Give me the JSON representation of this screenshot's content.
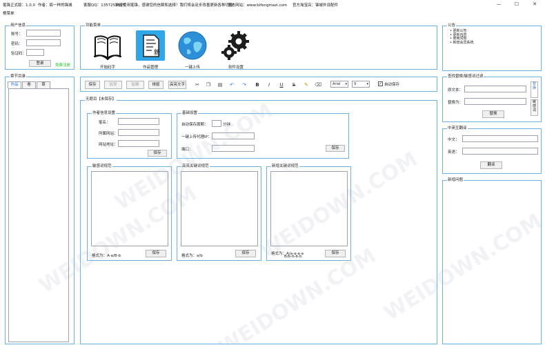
{
  "titlebar": {
    "app_name": "笔锋正式版：1.0.0",
    "author": "作者：疯一样的锋城",
    "qq": "客服QQ：1357252657",
    "welcome": "欢迎使用笔锋，感谢您的信赖和选择！我们将会足步改善更新各种功能！",
    "website": "官方网站：www.bifengmazi.com",
    "taobao": "官方淘宝店：锋城外设配件",
    "minimize": "—",
    "maximize": "☐",
    "close": "✕"
  },
  "menubar": {
    "label": "根菜单"
  },
  "user_info": {
    "title": "用户信息",
    "account_label": "账号：",
    "password_label": "密码：",
    "captcha_label": "验证码：",
    "login_button": "登录",
    "register_link": "免费注册"
  },
  "feature_menu": {
    "title": "功能菜单",
    "items": [
      {
        "label": "开始码字",
        "icon": "book-icon"
      },
      {
        "label": "作品管理",
        "icon": "document-icon"
      },
      {
        "label": "一键上传",
        "icon": "globe-icon"
      },
      {
        "label": "软件设置",
        "icon": "gears-icon"
      }
    ]
  },
  "notice": {
    "title": "公告",
    "items": [
      "更新公告",
      "更新内容",
      "使用须知",
      "新增会员系统"
    ]
  },
  "chapter_dir": {
    "title": "章节目录",
    "tabs": [
      "作品",
      "卷",
      "章"
    ]
  },
  "toolbar": {
    "save": "保存",
    "indent": "加窄",
    "add_stop": "加顿",
    "format": "排版",
    "highlight": "高亮文字",
    "font_name": "Arial",
    "font_size": "9",
    "autosave_label": "自动保存",
    "autosave_checked": true
  },
  "editor": {
    "title": "无题目【未保存】",
    "author_settings": {
      "title": "作者信息设置",
      "pen_name_label": "笔名：",
      "site_label": "所属网站：",
      "url_label": "网站地址：",
      "save_button": "保存"
    },
    "basic_settings": {
      "title": "基础设置",
      "autosave_cycle_label": "自动保存周期：",
      "minutes_unit": "分钟",
      "proxy_label": "一键上传代理IP：",
      "port_label": "端口：",
      "save_button": "保存"
    },
    "sensitive_words": {
      "title": "敏感词规范",
      "format": "格式为：A-a/B-b",
      "save_button": "保存"
    },
    "highlight_keywords": {
      "title": "高亮关键词规范",
      "format": "格式为：a/b",
      "save_button": "保存"
    },
    "new_keywords": {
      "title": "新增关键词规范",
      "format_line1": "格式为：A/a-a-a-a",
      "format_line2": "B/b-b-b-b",
      "save_button": "保存"
    }
  },
  "find_replace": {
    "title": "查找替换/敏感词过滤",
    "original_label": "原文本：",
    "replace_label": "替换为：",
    "replace_button": "替换",
    "side_tab_1": "替换",
    "side_tab_2": "敏感词"
  },
  "translate": {
    "title": "中英互翻译",
    "chinese_label": "中文：",
    "english_label": "英语：",
    "translate_button": "翻译"
  },
  "new_questions": {
    "title": "新增问题"
  },
  "watermark": "WEIDOWN.COM"
}
